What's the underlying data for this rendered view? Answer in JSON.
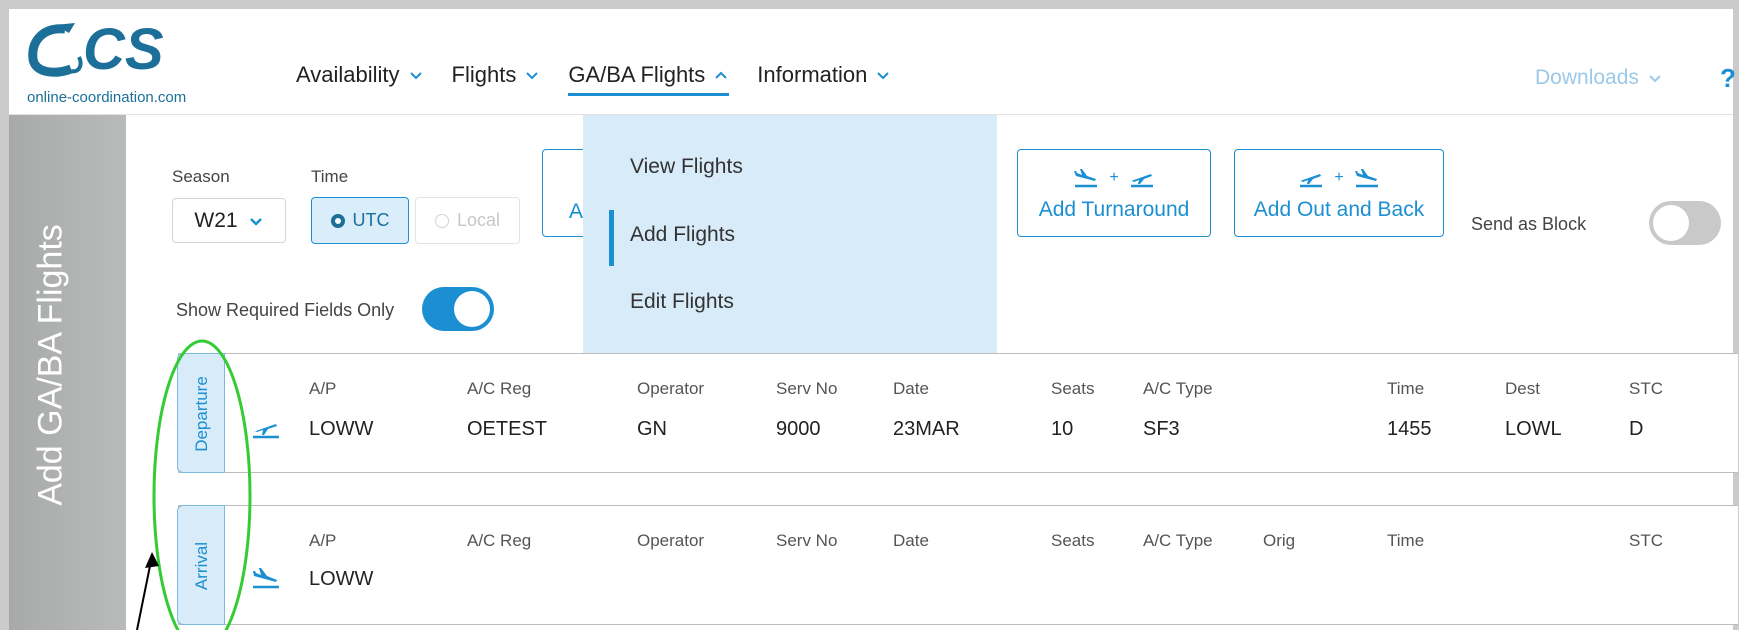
{
  "logo": {
    "text": "OCS",
    "url": "online-coordination.com"
  },
  "nav": {
    "items": [
      {
        "label": "Availability"
      },
      {
        "label": "Flights"
      },
      {
        "label": "GA/BA Flights"
      },
      {
        "label": "Information"
      }
    ],
    "downloads": "Downloads",
    "help": "?"
  },
  "sidebar": {
    "title": "Add GA/BA Flights"
  },
  "form": {
    "season_label": "Season",
    "season_value": "W21",
    "time_label": "Time",
    "time_utc": "UTC",
    "time_local": "Local",
    "hidden_button_partial": "A",
    "add_turnaround": "Add Turnaround",
    "add_out_and_back": "Add Out and Back",
    "send_as_block": "Send as Block",
    "show_required": "Show Required Fields Only"
  },
  "dropdown": {
    "items": [
      {
        "label": "View Flights"
      },
      {
        "label": "Add Flights"
      },
      {
        "label": "Edit Flights"
      }
    ]
  },
  "departure": {
    "tab": "Departure",
    "headers": [
      "A/P",
      "A/C Reg",
      "Operator",
      "Serv No",
      "Date",
      "Seats",
      "A/C Type",
      "Time",
      "Dest",
      "STC"
    ],
    "values": [
      "LOWW",
      "OETEST",
      "GN",
      "9000",
      "23MAR",
      "10",
      "SF3",
      "1455",
      "LOWL",
      "D"
    ]
  },
  "arrival": {
    "tab": "Arrival",
    "headers": [
      "A/P",
      "A/C Reg",
      "Operator",
      "Serv No",
      "Date",
      "Seats",
      "A/C Type",
      "Orig",
      "Time",
      "STC"
    ],
    "values": [
      "LOWW"
    ]
  },
  "colors": {
    "accent": "#1b8fd1",
    "annotation": "#33cc33"
  }
}
